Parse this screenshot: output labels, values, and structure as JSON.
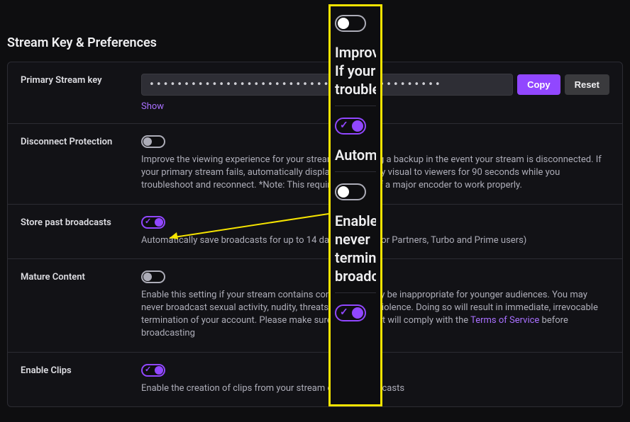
{
  "pageTitle": "Stream Key & Preferences",
  "streamKey": {
    "label": "Primary Stream key",
    "maskedValue": "••••••••••••••••••••••••••••••••••••••••••",
    "showLabel": "Show",
    "copyLabel": "Copy",
    "resetLabel": "Reset"
  },
  "disconnect": {
    "label": "Disconnect Protection",
    "enabled": false,
    "desc": "Improve the viewing experience for your stream by enabling a backup in the event your stream is disconnected. If your primary stream fails, automatically display a temporary visual to viewers for 90 seconds while you troubleshoot and reconnect. *Note: This requires the use of a major encoder to work properly."
  },
  "store": {
    "label": "Store past broadcasts",
    "enabled": true,
    "desc": "Automatically save broadcasts for up to 14 days (60 days for Partners, Turbo and Prime users)"
  },
  "mature": {
    "label": "Mature Content",
    "enabled": false,
    "descA": "Enable this setting if your stream contains content that may be inappropriate for younger audiences. You may never broadcast sexual activity, nudity, threats or extreme violence. Doing so will result in immediate, irrevocable termination of your account. Please make sure your content will comply with the ",
    "tosLabel": "Terms of Service",
    "descB": " before broadcasting"
  },
  "clips": {
    "label": "Enable Clips",
    "enabled": true,
    "desc": "Enable the creation of clips from your stream or past broadcasts"
  },
  "callout": {
    "seg1": {
      "enabled": false,
      "text": "Improv\nIf your\ntrouble"
    },
    "seg2": {
      "enabled": true,
      "text": "Autom"
    },
    "seg3": {
      "enabled": false,
      "text": "Enable\nnever\ntermin\nbroadc"
    },
    "seg4": {
      "enabled": true,
      "text": ""
    }
  }
}
